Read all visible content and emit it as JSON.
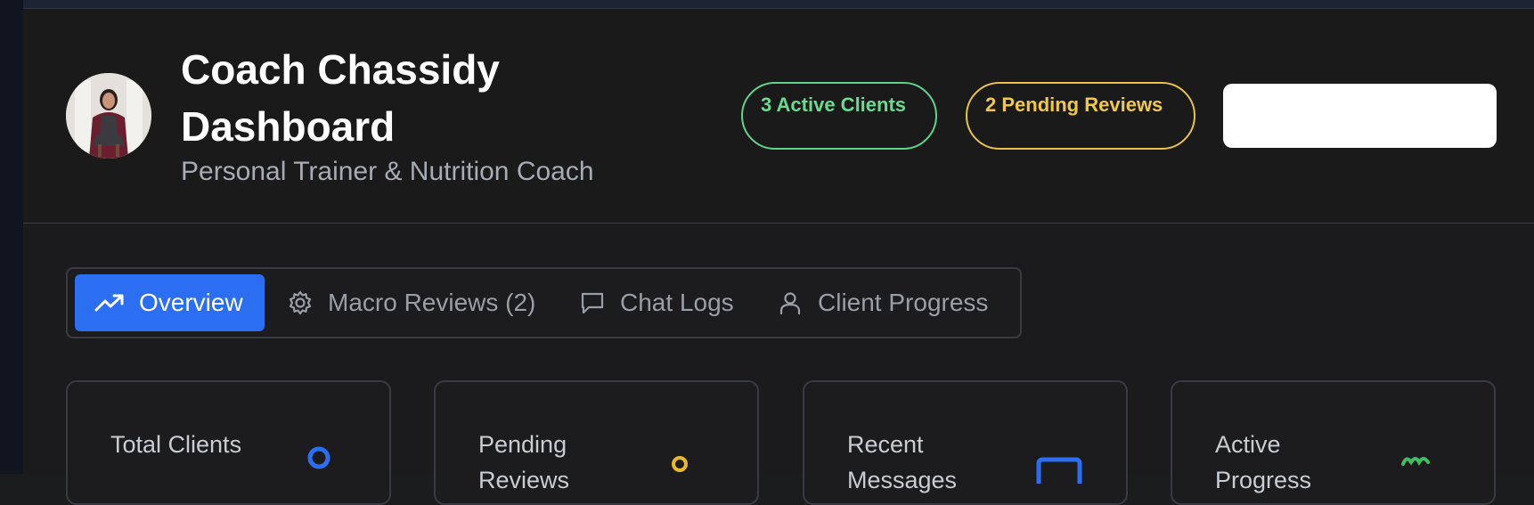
{
  "header": {
    "title": "Coach Chassidy Dashboard",
    "subtitle": "Personal Trainer & Nutrition Coach",
    "badges": {
      "active": "3 Active Clients",
      "pending": "2 Pending Reviews"
    }
  },
  "tabs": [
    {
      "label": "Overview",
      "icon": "trending-up-icon",
      "active": true
    },
    {
      "label": "Macro Reviews (2)",
      "icon": "gear-icon",
      "active": false
    },
    {
      "label": "Chat Logs",
      "icon": "chat-bubble-icon",
      "active": false
    },
    {
      "label": "Client Progress",
      "icon": "user-icon",
      "active": false
    }
  ],
  "cards": [
    {
      "label": "Total Clients",
      "icon": "users-icon",
      "icon_color": "#2b6ef2"
    },
    {
      "label": "Pending Reviews",
      "icon": "clock-icon",
      "icon_color": "#e9b82f"
    },
    {
      "label": "Recent Messages",
      "icon": "message-icon",
      "icon_color": "#2b6ef2"
    },
    {
      "label": "Active Progress",
      "icon": "activity-icon",
      "icon_color": "#3fbf63"
    }
  ],
  "colors": {
    "accent": "#2b6ef2",
    "success": "#5fd48a",
    "warning": "#e9c24d"
  }
}
